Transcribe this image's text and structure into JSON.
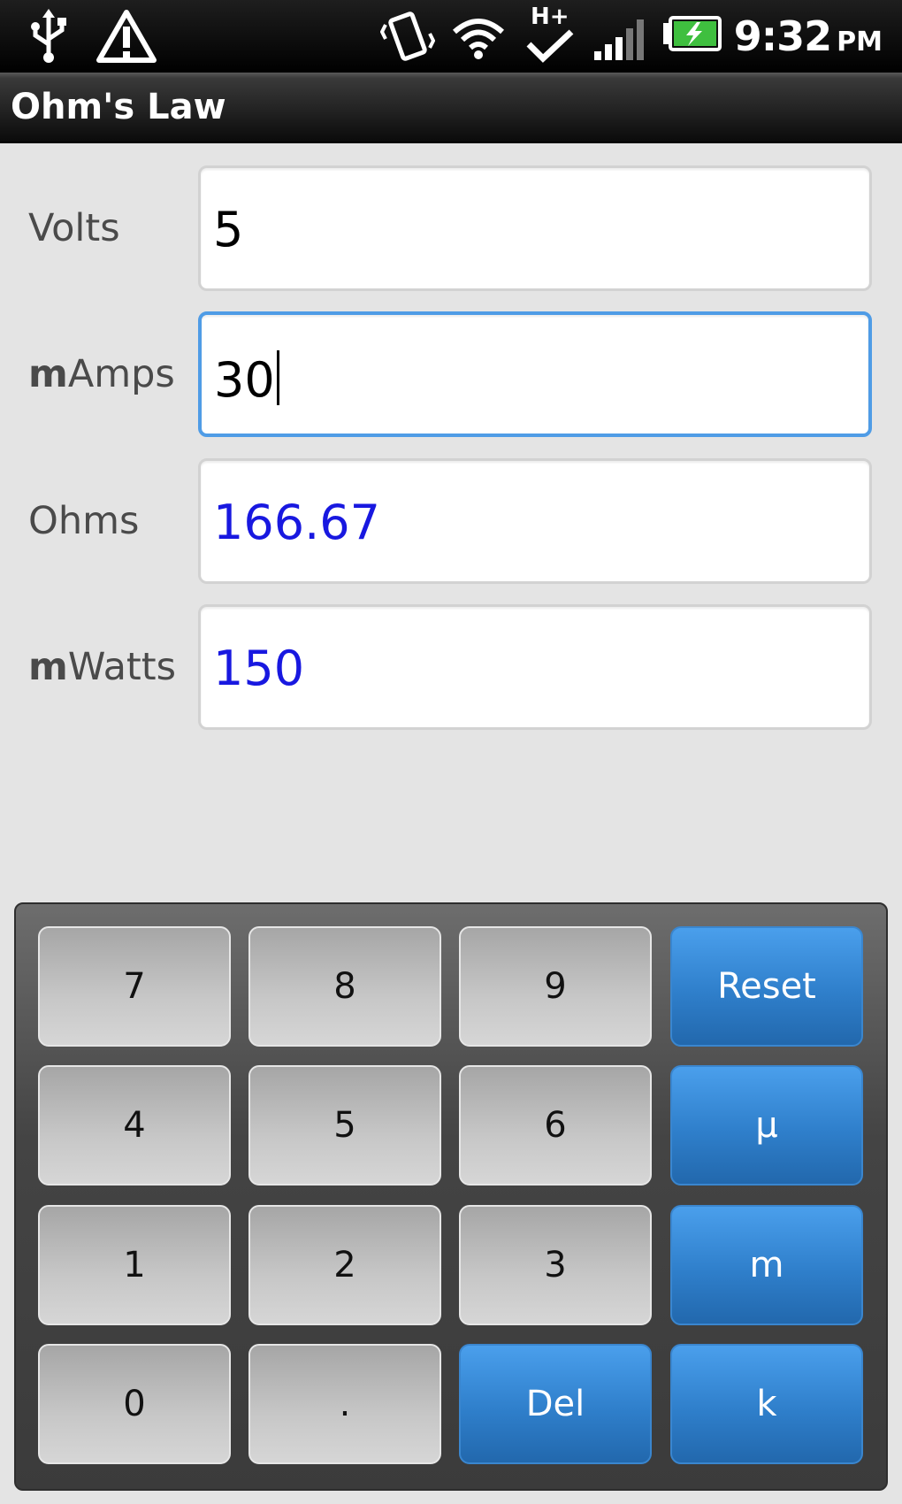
{
  "status_bar": {
    "icons": [
      "usb-icon",
      "warning-icon",
      "vibrate-icon",
      "wifi-icon",
      "hplus-sync-icon",
      "signal-icon",
      "battery-charging-icon"
    ],
    "hplus_label": "H+",
    "time": "9:32",
    "ampm": "PM"
  },
  "app": {
    "title": "Ohm's Law"
  },
  "form": {
    "rows": [
      {
        "prefix": "",
        "label": "Volts",
        "value": "5",
        "focused": false,
        "computed": false
      },
      {
        "prefix": "m",
        "label": "Amps",
        "value": "30",
        "focused": true,
        "computed": false
      },
      {
        "prefix": "",
        "label": "Ohms",
        "value": "166.67",
        "focused": false,
        "computed": true
      },
      {
        "prefix": "m",
        "label": "Watts",
        "value": "150",
        "focused": false,
        "computed": true
      }
    ],
    "result_color": "#1818e0",
    "focus_color": "#4f9ce6"
  },
  "keypad": {
    "keys": [
      [
        "7",
        "8",
        "9",
        "Reset"
      ],
      [
        "4",
        "5",
        "6",
        "µ"
      ],
      [
        "1",
        "2",
        "3",
        "m"
      ],
      [
        "0",
        ".",
        "Del",
        "k"
      ]
    ],
    "accent": "#2f7fcb"
  }
}
